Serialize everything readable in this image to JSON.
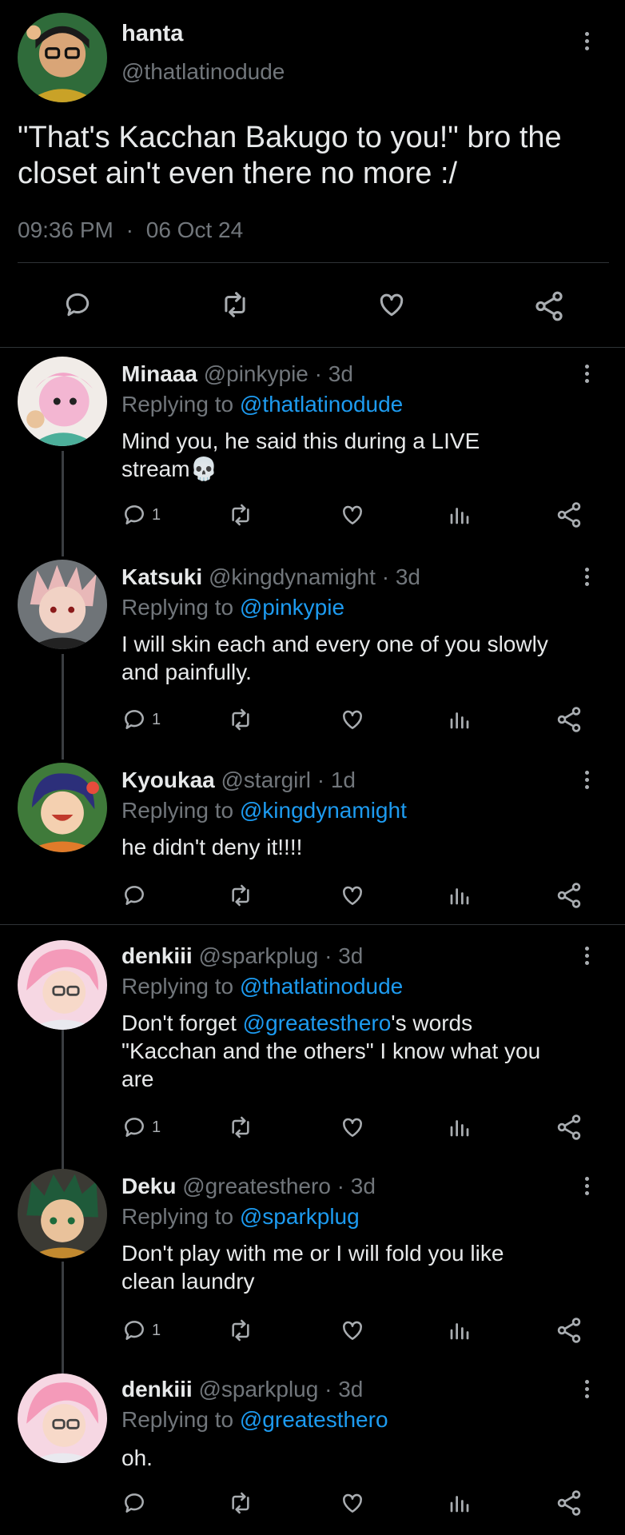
{
  "main_post": {
    "name": "hanta",
    "handle": "@thatlatinodude",
    "text_line1": "\"That's Kacchan Bakugo to you!\" bro the",
    "text_line2": "closet ain't even there no more :/",
    "time": "09:36 PM",
    "separator": "·",
    "date": "06 Oct 24"
  },
  "replies": [
    {
      "name": "Minaaa",
      "handle": "@pinkypie",
      "sep": "·",
      "age": "3d",
      "replying_prefix": "Replying to",
      "replying_to": "@thatlatinodude",
      "line1": "Mind you, he said this during a LIVE",
      "line2": "stream",
      "emoji": "💀",
      "reply_count": "1"
    },
    {
      "name": "Katsuki",
      "handle": "@kingdynamight",
      "sep": "·",
      "age": "3d",
      "replying_prefix": "Replying to",
      "replying_to": "@pinkypie",
      "line1": "I will skin each and every one of you slowly",
      "line2": "and painfully.",
      "reply_count": "1"
    },
    {
      "name": "Kyoukaa",
      "handle": "@stargirl",
      "sep": "·",
      "age": "1d",
      "replying_prefix": "Replying to",
      "replying_to": "@kingdynamight",
      "line1": "he didn't deny it!!!!",
      "reply_count": ""
    },
    {
      "name": "denkiii",
      "handle": "@sparkplug",
      "sep": "·",
      "age": "3d",
      "replying_prefix": "Replying to",
      "replying_to": "@thatlatinodude",
      "line1_pre": "Don't forget ",
      "line1_mention": "@greatesthero",
      "line1_post": "'s words",
      "line2": "\"Kacchan and the others\" I know what you",
      "line3": "are",
      "reply_count": "1"
    },
    {
      "name": "Deku",
      "handle": "@greatesthero",
      "sep": "·",
      "age": "3d",
      "replying_prefix": "Replying to",
      "replying_to": "@sparkplug",
      "line1": "Don't play with me or I will fold you like",
      "line2": "clean laundry",
      "reply_count": "1"
    },
    {
      "name": "denkiii",
      "handle": "@sparkplug",
      "sep": "·",
      "age": "3d",
      "replying_prefix": "Replying to",
      "replying_to": "@greatesthero",
      "line1": "oh.",
      "reply_count": ""
    }
  ],
  "colors": {
    "background": "#000000",
    "text": "#e7e9ea",
    "muted": "#71767b",
    "link": "#1d9bf0",
    "divider": "#2f3336"
  },
  "icons": [
    "more-vertical-icon",
    "reply-icon",
    "retweet-icon",
    "like-icon",
    "views-icon",
    "share-icon"
  ]
}
